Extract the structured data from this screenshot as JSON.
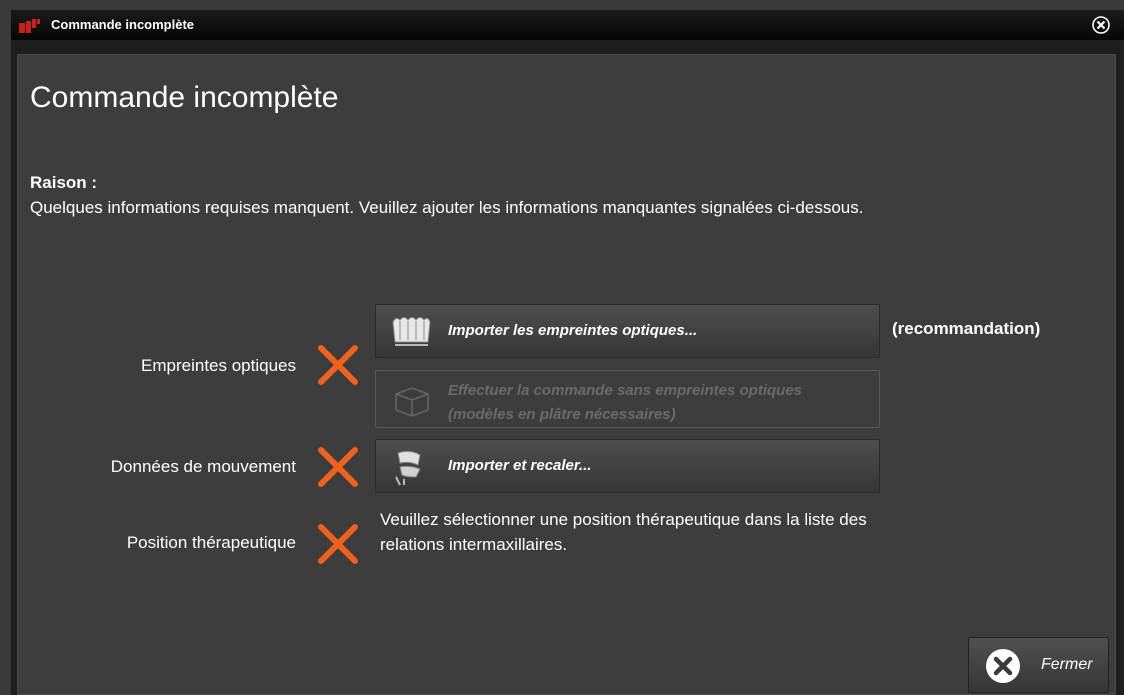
{
  "window": {
    "title": "Commande incomplète",
    "logo_icon": "app-logo-icon",
    "close_icon": "close-circle-icon"
  },
  "heading": "Commande incomplète",
  "reason": {
    "label": "Raison :",
    "text": "Quelques informations requises manquent. Veuillez ajouter les informations manquantes signalées ci-dessous."
  },
  "rows": [
    {
      "label": "Empreintes optiques",
      "status_icon": "missing-x-icon"
    },
    {
      "label": "Données de mouvement",
      "status_icon": "missing-x-icon"
    },
    {
      "label": "Position thérapeutique",
      "status_icon": "missing-x-icon"
    }
  ],
  "buttons": {
    "import_scans": {
      "label": "Importer les empreintes optiques...",
      "icon": "optical-impressions-icon"
    },
    "recommendation": "(recommandation)",
    "order_without": {
      "label": "Effectuer la commande sans empreintes optiques (modèles en plâtre nécessaires)",
      "icon": "plaster-model-box-icon",
      "enabled": false
    },
    "import_register": {
      "label": "Importer et recaler...",
      "icon": "jaw-motion-icon"
    }
  },
  "therapeutic_info": "Veuillez sélectionner une position thérapeutique dans la liste des relations intermaxillaires.",
  "footer": {
    "close_label": "Fermer",
    "close_icon": "close-circle-icon"
  },
  "colors": {
    "accent_x": "#f0601e",
    "background": "#3d3d3d",
    "titlebar": "#0a0a0a"
  }
}
